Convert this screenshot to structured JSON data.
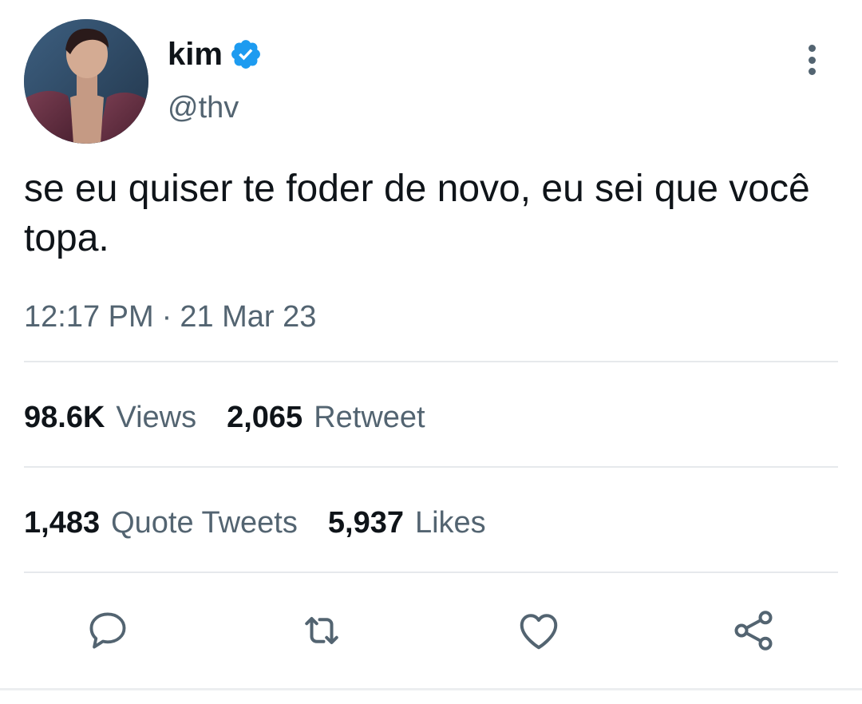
{
  "user": {
    "display_name": "kim",
    "handle": "@thv",
    "verified": true
  },
  "tweet": {
    "text": "se eu quiser te foder de novo, eu sei que você topa.",
    "time": "12:17 PM",
    "separator": "·",
    "date": "21 Mar 23"
  },
  "stats": {
    "views_count": "98.6K",
    "views_label": "Views",
    "retweets_count": "2,065",
    "retweets_label": "Retweet",
    "quotes_count": "1,483",
    "quotes_label": "Quote Tweets",
    "likes_count": "5,937",
    "likes_label": "Likes"
  },
  "icons": {
    "verified": "verified-badge-icon",
    "more": "more-vertical-icon",
    "reply": "reply-icon",
    "retweet": "retweet-icon",
    "like": "heart-icon",
    "share": "share-icon"
  },
  "colors": {
    "text_primary": "#0f1419",
    "text_secondary": "#536471",
    "verified_blue": "#1d9bf0",
    "divider": "#e6e9ec"
  }
}
